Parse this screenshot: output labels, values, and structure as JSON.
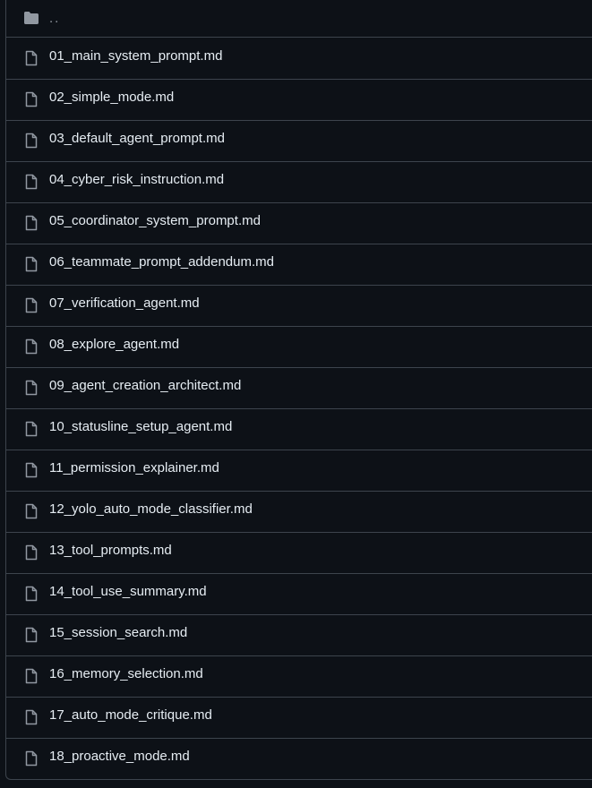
{
  "parent_dir": {
    "label": "..",
    "icon": "folder-icon"
  },
  "files": [
    {
      "name": "01_main_system_prompt.md",
      "icon": "file-icon"
    },
    {
      "name": "02_simple_mode.md",
      "icon": "file-icon"
    },
    {
      "name": "03_default_agent_prompt.md",
      "icon": "file-icon"
    },
    {
      "name": "04_cyber_risk_instruction.md",
      "icon": "file-icon"
    },
    {
      "name": "05_coordinator_system_prompt.md",
      "icon": "file-icon"
    },
    {
      "name": "06_teammate_prompt_addendum.md",
      "icon": "file-icon"
    },
    {
      "name": "07_verification_agent.md",
      "icon": "file-icon"
    },
    {
      "name": "08_explore_agent.md",
      "icon": "file-icon"
    },
    {
      "name": "09_agent_creation_architect.md",
      "icon": "file-icon"
    },
    {
      "name": "10_statusline_setup_agent.md",
      "icon": "file-icon"
    },
    {
      "name": "11_permission_explainer.md",
      "icon": "file-icon"
    },
    {
      "name": "12_yolo_auto_mode_classifier.md",
      "icon": "file-icon"
    },
    {
      "name": "13_tool_prompts.md",
      "icon": "file-icon"
    },
    {
      "name": "14_tool_use_summary.md",
      "icon": "file-icon"
    },
    {
      "name": "15_session_search.md",
      "icon": "file-icon"
    },
    {
      "name": "16_memory_selection.md",
      "icon": "file-icon"
    },
    {
      "name": "17_auto_mode_critique.md",
      "icon": "file-icon"
    },
    {
      "name": "18_proactive_mode.md",
      "icon": "file-icon"
    }
  ],
  "colors": {
    "background": "#0d1117",
    "border": "#3d444d",
    "text": "#e6edf3",
    "icon": "#9198a1"
  }
}
